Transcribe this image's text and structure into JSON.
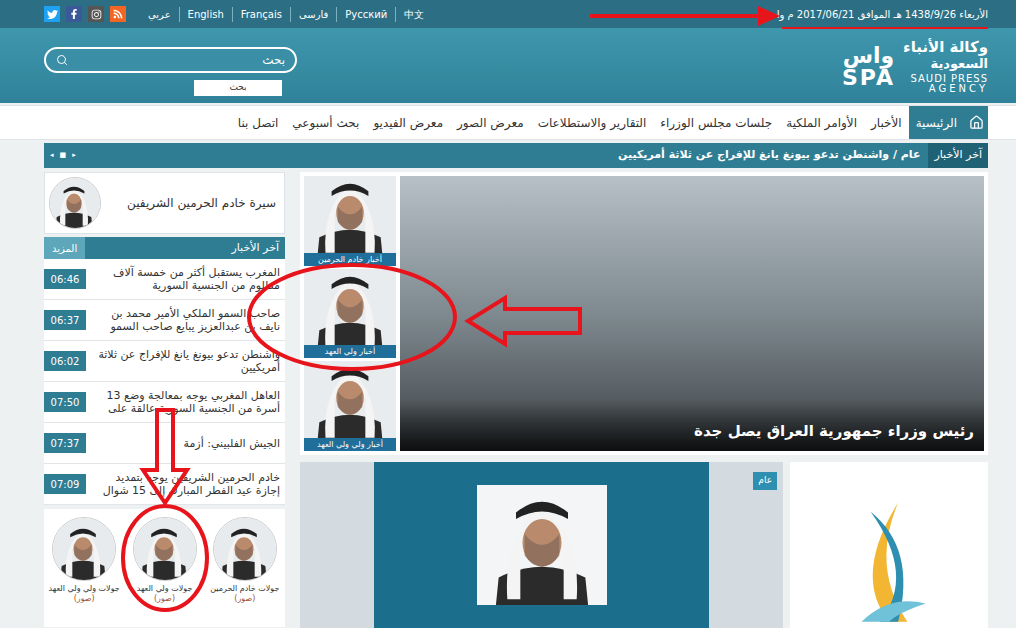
{
  "top_bar": {
    "date": "الأربعاء 1438/9/26 هـ الموافق 2017/06/21 م واس",
    "date_highlighted": true,
    "languages": [
      "عربي",
      "English",
      "Français",
      "فارسی",
      "Русский",
      "中文"
    ]
  },
  "header": {
    "logo": {
      "ar_line1": "وكالة الأنباء",
      "ar_line2": "السعودية",
      "en_line1": "SAUDI PRESS",
      "en_line2": "AGENCY",
      "mark_ar": "واس",
      "mark_en": "SPA"
    },
    "search": {
      "placeholder": "بحث",
      "button": "بحث"
    }
  },
  "nav": [
    {
      "label": "الرئيسية",
      "selected": true
    },
    {
      "label": "الأخبار",
      "selected": false
    },
    {
      "label": "الأوامر الملكية",
      "selected": false
    },
    {
      "label": "جلسات مجلس الوزراء",
      "selected": false
    },
    {
      "label": "التقارير والاستطلاعات",
      "selected": false
    },
    {
      "label": "معرض الصور",
      "selected": false
    },
    {
      "label": "معرض الفيديو",
      "selected": false
    },
    {
      "label": "بحث أسبوعي",
      "selected": false
    },
    {
      "label": "اتصل بنا",
      "selected": false
    }
  ],
  "ticker": {
    "label": "آخر الأخبار",
    "text": "عام / واشنطن تدعو بيونغ يانغ للإفراج عن ثلاثة أمريكيين",
    "controls": [
      "◂",
      "■",
      "▸"
    ]
  },
  "bio_card": {
    "title": "سيرة خادم الحرمين الشريفين"
  },
  "latest": {
    "title": "آخر الأخبار",
    "more": "المزيد",
    "items": [
      {
        "text": "المغرب يستقبل أكثر من خمسة آلاف مظلوم من الجنسية السورية",
        "time": "06:46"
      },
      {
        "text": "صاحب السمو الملكي الأمير محمد بن نايف بن عبدالعزيز يبايع صاحب السمو",
        "time": "06:37"
      },
      {
        "text": "واشنطن تدعو بيونغ يانغ للإفراج عن ثلاثة أمريكيين",
        "time": "06:02"
      },
      {
        "text": "العاهل المغربي يوجه بمعالجة وضع 13 أسرة من الجنسية السورية عالقة على",
        "time": "07:50"
      },
      {
        "text": "الجيش الفلبيني: أزمة",
        "time": "07:37"
      },
      {
        "text": "خادم الحرمين الشريفين يوجه بتمديد إجازة عيد الفطر المبارك إلى 15 شوال",
        "time": "07:09"
      }
    ]
  },
  "tours": [
    {
      "label": "جولات خادم الحرمين",
      "sub": "(صور)",
      "highlighted": false
    },
    {
      "label": "جولات ولي العهد",
      "sub": "(صور)",
      "highlighted": true
    },
    {
      "label": "جولات ولي ولي العهد",
      "sub": "(صور)",
      "highlighted": false
    }
  ],
  "feature": {
    "caption": "رئيس وزراء جمهورية العراق يصل جدة",
    "thumbs": [
      {
        "label": "أخبار خادم الحرمين",
        "highlighted": false
      },
      {
        "label": "أخبار ولي العهد",
        "highlighted": true
      },
      {
        "label": "أخبار ولي ولي العهد",
        "highlighted": false
      }
    ]
  },
  "card": {
    "tag": "عام"
  }
}
